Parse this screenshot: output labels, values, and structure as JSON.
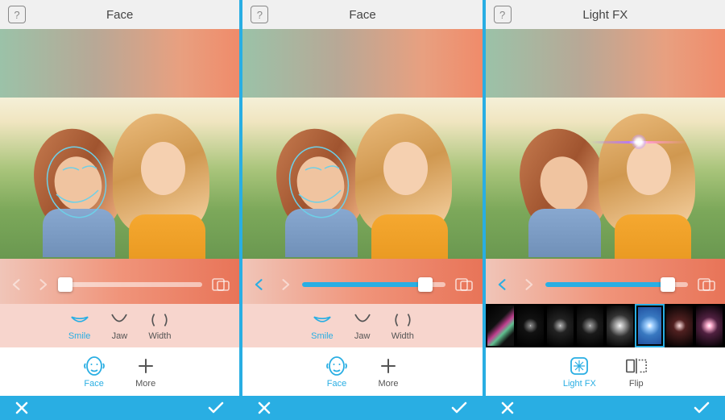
{
  "panels": [
    {
      "help": "?",
      "title": "Face",
      "slider": {
        "fill": 0,
        "thumb": 4,
        "backEnabled": false
      },
      "tools": [
        {
          "name": "smile",
          "label": "Smile",
          "active": true
        },
        {
          "name": "jaw",
          "label": "Jaw",
          "active": false
        },
        {
          "name": "width",
          "label": "Width",
          "active": false
        }
      ],
      "categories": [
        {
          "name": "face",
          "label": "Face",
          "active": true
        },
        {
          "name": "more",
          "label": "More",
          "active": false
        }
      ]
    },
    {
      "help": "?",
      "title": "Face",
      "slider": {
        "fill": 86,
        "thumb": 86,
        "backEnabled": true
      },
      "tools": [
        {
          "name": "smile",
          "label": "Smile",
          "active": true
        },
        {
          "name": "jaw",
          "label": "Jaw",
          "active": false
        },
        {
          "name": "width",
          "label": "Width",
          "active": false
        }
      ],
      "categories": [
        {
          "name": "face",
          "label": "Face",
          "active": true
        },
        {
          "name": "more",
          "label": "More",
          "active": false
        }
      ]
    },
    {
      "help": "?",
      "title": "Light FX",
      "slider": {
        "fill": 86,
        "thumb": 86,
        "backEnabled": true
      },
      "fx": [
        {
          "name": "rainbow",
          "sel": false
        },
        {
          "name": "spark1",
          "sel": false
        },
        {
          "name": "spark2",
          "sel": false
        },
        {
          "name": "spark3",
          "sel": false
        },
        {
          "name": "burst",
          "sel": false
        },
        {
          "name": "flare-blue",
          "sel": true
        },
        {
          "name": "lens1",
          "sel": false
        },
        {
          "name": "lens2",
          "sel": false
        }
      ],
      "categories": [
        {
          "name": "lightfx",
          "label": "Light FX",
          "active": true
        },
        {
          "name": "flip",
          "label": "Flip",
          "active": false
        }
      ]
    }
  ]
}
